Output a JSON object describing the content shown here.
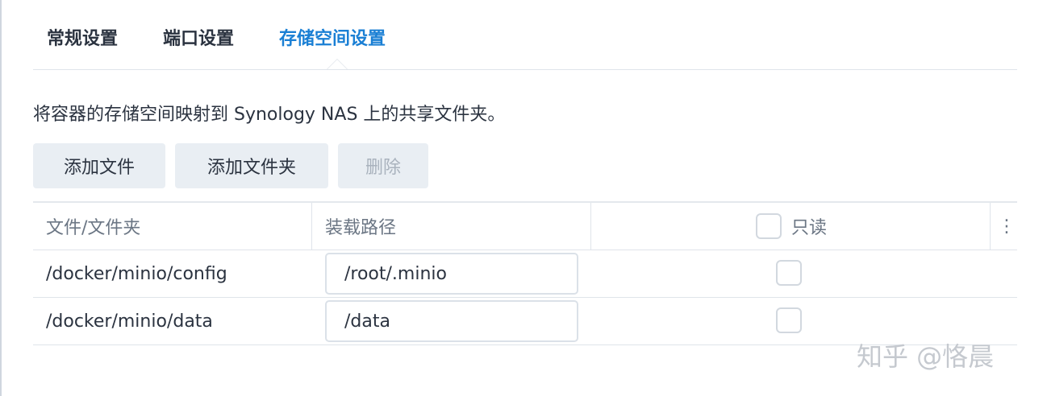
{
  "tabs": {
    "general": "常规设置",
    "port": "端口设置",
    "storage": "存储空间设置"
  },
  "description": "将容器的存储空间映射到 Synology NAS 上的共享文件夹。",
  "toolbar": {
    "add_file": "添加文件",
    "add_folder": "添加文件夹",
    "delete": "删除"
  },
  "table": {
    "headers": {
      "source": "文件/文件夹",
      "mount_path": "装载路径",
      "read_only": "只读",
      "menu_icon": "⋮"
    },
    "rows": [
      {
        "source": "/docker/minio/config",
        "mount_path": "/root/.minio",
        "read_only": false
      },
      {
        "source": "/docker/minio/data",
        "mount_path": "/data",
        "read_only": false
      }
    ]
  },
  "watermark": "知乎 @恪晨",
  "colors": {
    "accent": "#1a7fd4",
    "button_bg": "#e9eef3",
    "disabled_text": "#a9b2bd",
    "border": "#dfe4ea"
  }
}
